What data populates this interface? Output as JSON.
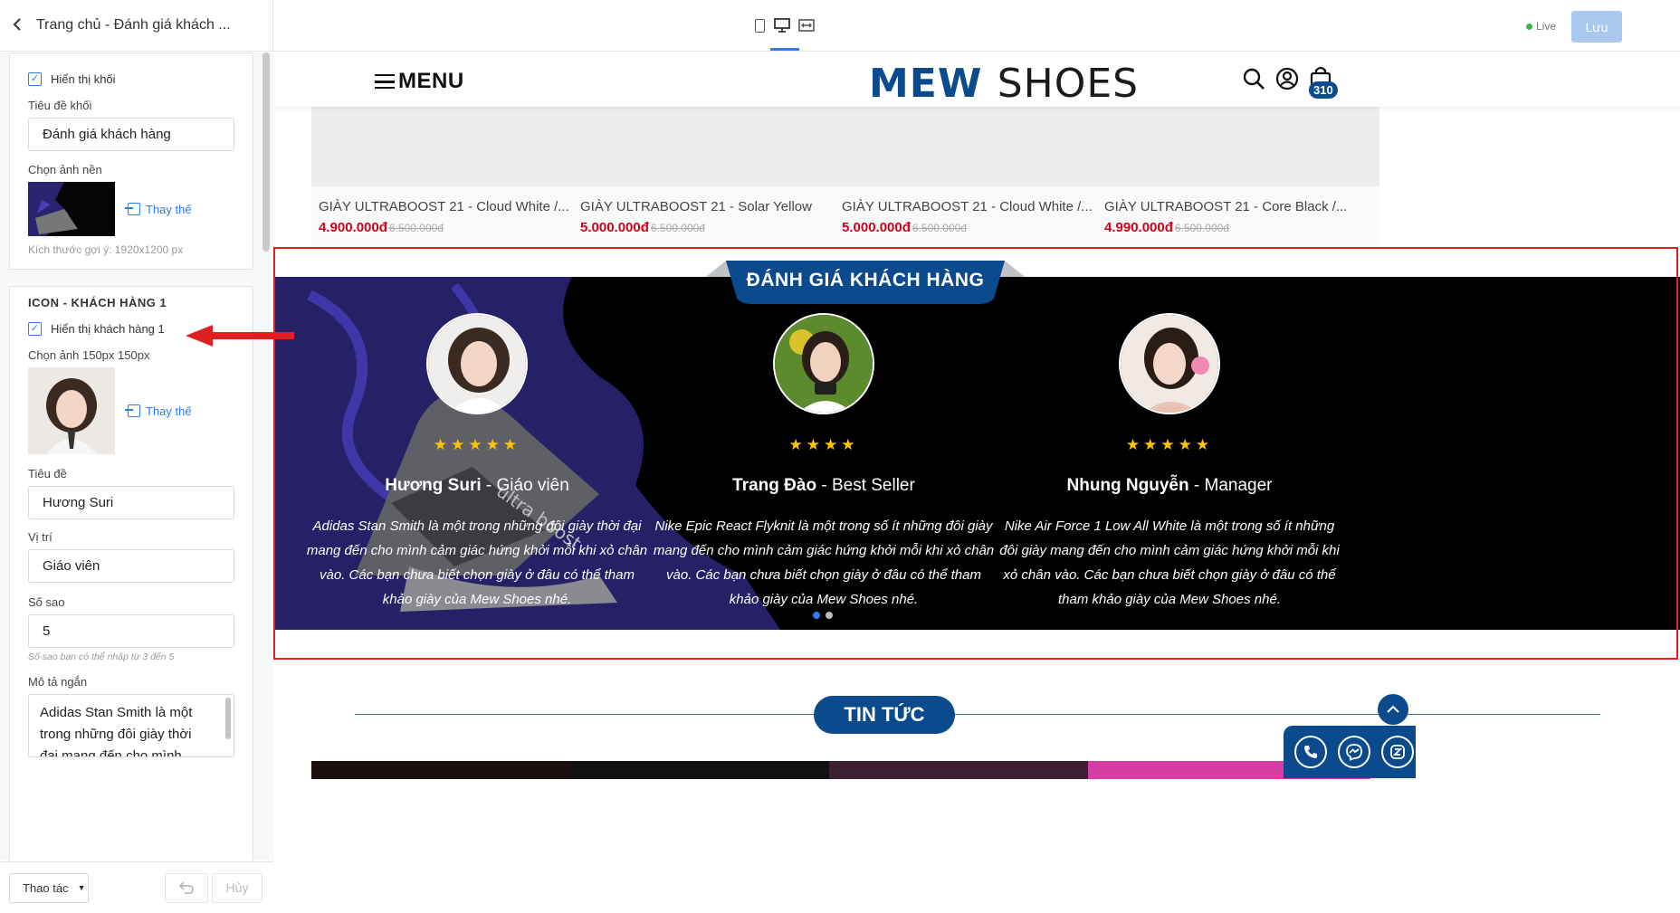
{
  "sidebar": {
    "back_icon": "chevron-left-icon",
    "title": "Trang chủ - Đánh giá khách ...",
    "block": {
      "show_label": "Hiển thị khối",
      "title_label": "Tiêu đề khối",
      "title_value": "Đánh giá khách hàng",
      "bg_label": "Chọn ảnh nền",
      "replace": "Thay thế",
      "size_hint": "Kích thước gợi ý: 1920x1200 px"
    },
    "customer1": {
      "section_title": "ICON - KHÁCH HÀNG 1",
      "show_label": "Hiển thị khách hàng 1",
      "image_label": "Chọn ảnh 150px 150px",
      "replace": "Thay thế",
      "name_label": "Tiêu đề",
      "name_value": "Hương Suri",
      "position_label": "Vị trí",
      "position_value": "Giáo viên",
      "stars_label": "Số sao",
      "stars_value": "5",
      "stars_hint": "Số sao bạn có thể nhập từ 3 đến 5",
      "desc_label": "Mô tả ngắn",
      "desc_value": "Adidas Stan Smith là một trong những đôi giày thời đại mang đến cho mình"
    },
    "footer": {
      "actions_label": "Thao tác",
      "cancel_label": "Hủy"
    }
  },
  "topbar": {
    "live_label": "Live",
    "save_label": "Lưu"
  },
  "site": {
    "menu_label": "MENU",
    "logo_a": "MEW",
    "logo_b": "SHOES",
    "cart_count": "310",
    "products": [
      {
        "name": "GIÀY ULTRABOOST 21 - Cloud White /...",
        "price": "4.900.000đ",
        "old": "6.500.000đ"
      },
      {
        "name": "GIÀY ULTRABOOST 21 - Solar Yellow",
        "price": "5.000.000đ",
        "old": "6.500.000đ"
      },
      {
        "name": "GIÀY ULTRABOOST 21 - Cloud White /...",
        "price": "5.000.000đ",
        "old": "6.500.000đ"
      },
      {
        "name": "GIÀY ULTRABOOST 21 - Core Black /...",
        "price": "4.990.000đ",
        "old": "6.500.000đ"
      }
    ],
    "reviews_title": "ĐÁNH GIÁ KHÁCH HÀNG",
    "reviews": [
      {
        "name": "Hương Suri",
        "sep": " - ",
        "role": "Giáo viên",
        "stars": 5,
        "stars_text": "★★★★★",
        "text": "Adidas Stan Smith là một trong những đôi giày thời đại mang đến cho mình cảm giác hứng khởi mỗi khi xỏ chân vào. Các bạn chưa biết chọn giày ở đâu có thể tham khảo giày của Mew Shoes nhé."
      },
      {
        "name": "Trang Đào",
        "sep": " - ",
        "role": "Best Seller",
        "stars": 4,
        "stars_text": "★★★★",
        "text": "Nike Epic React Flyknit là một trong số ít những đôi giày mang đến cho mình cảm giác hứng khởi mỗi khi xỏ chân vào. Các bạn chưa biết chọn giày ở đâu có thể tham khảo giày của Mew Shoes nhé."
      },
      {
        "name": "Nhung Nguyễn",
        "sep": " - ",
        "role": "Manager",
        "stars": 5,
        "stars_text": "★★★★★",
        "text": "Nike Air Force 1 Low All White là một trong số ít những đôi giày mang đến cho mình cảm giác hứng khởi mỗi khi xỏ chân vào. Các bạn chưa biết chọn giày ở đâu có thể tham khảo giày của Mew Shoes nhé."
      }
    ],
    "carousel": {
      "pages": 2,
      "active": 1
    },
    "news_title": "TIN TỨC"
  },
  "colors": {
    "brand": "#0b4a8c",
    "accent": "#2b7de9",
    "price": "#d0021b",
    "star": "#ffc400",
    "highlight": "#e02020"
  }
}
